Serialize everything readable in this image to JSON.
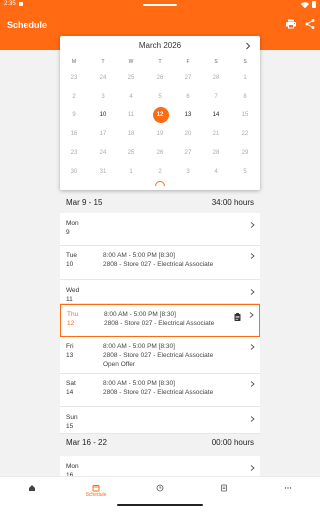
{
  "status_bar": {
    "time": "2:35"
  },
  "app_bar": {
    "title": "Schedule",
    "icons": [
      "print-icon",
      "share-icon"
    ]
  },
  "calendar": {
    "month_title": "March 2026",
    "weekdays": [
      "M",
      "T",
      "W",
      "T",
      "F",
      "S",
      "S"
    ],
    "weeks": [
      [
        {
          "d": "23"
        },
        {
          "d": "24"
        },
        {
          "d": "25"
        },
        {
          "d": "26"
        },
        {
          "d": "27"
        },
        {
          "d": "28"
        },
        {
          "d": "1"
        }
      ],
      [
        {
          "d": "2"
        },
        {
          "d": "3"
        },
        {
          "d": "4"
        },
        {
          "d": "5"
        },
        {
          "d": "6"
        },
        {
          "d": "7"
        },
        {
          "d": "8"
        }
      ],
      [
        {
          "d": "9"
        },
        {
          "d": "10",
          "cur": true
        },
        {
          "d": "11"
        },
        {
          "d": "12",
          "today": true
        },
        {
          "d": "13",
          "cur": true
        },
        {
          "d": "14",
          "cur": true
        },
        {
          "d": "15"
        }
      ],
      [
        {
          "d": "16"
        },
        {
          "d": "17"
        },
        {
          "d": "18"
        },
        {
          "d": "19"
        },
        {
          "d": "20"
        },
        {
          "d": "21"
        },
        {
          "d": "22"
        }
      ],
      [
        {
          "d": "23"
        },
        {
          "d": "24"
        },
        {
          "d": "25"
        },
        {
          "d": "26"
        },
        {
          "d": "27"
        },
        {
          "d": "28"
        },
        {
          "d": "29"
        }
      ],
      [
        {
          "d": "30"
        },
        {
          "d": "31"
        },
        {
          "d": "1"
        },
        {
          "d": "2"
        },
        {
          "d": "3"
        },
        {
          "d": "4"
        },
        {
          "d": "5"
        }
      ]
    ]
  },
  "weeks": [
    {
      "range": "Mar 9 - 15",
      "hours": "34:00 hours",
      "days": [
        {
          "name": "Mon",
          "num": "9",
          "lines": []
        },
        {
          "name": "Tue",
          "num": "10",
          "lines": [
            "8:00 AM - 5:00 PM [8:30]",
            "2808 - Store 027 - Electrical Associate"
          ]
        },
        {
          "name": "Wed",
          "num": "11",
          "lines": []
        },
        {
          "name": "Thu",
          "num": "12",
          "lines": [
            "8:00 AM - 5:00 PM [8:30]",
            "2808 - Store 027 - Electrical Associate"
          ],
          "selected": true,
          "note": true
        },
        {
          "name": "Fri",
          "num": "13",
          "lines": [
            "8:00 AM - 5:00 PM [8:30]",
            "2808 - Store 027 - Electrical Associate",
            "Open Offer"
          ]
        },
        {
          "name": "Sat",
          "num": "14",
          "lines": [
            "8:00 AM - 5:00 PM [8:30]",
            "2808 - Store 027 - Electrical Associate"
          ]
        },
        {
          "name": "Sun",
          "num": "15",
          "lines": []
        }
      ]
    },
    {
      "range": "Mar 16 - 22",
      "hours": "00:00 hours",
      "days": [
        {
          "name": "Mon",
          "num": "16",
          "lines": []
        }
      ]
    }
  ],
  "bottom_nav": {
    "items": [
      {
        "icon": "home-icon",
        "label": ""
      },
      {
        "icon": "calendar-icon",
        "label": "Schedule",
        "active": true
      },
      {
        "icon": "clock-icon",
        "label": ""
      },
      {
        "icon": "timecard-icon",
        "label": ""
      },
      {
        "icon": "more-icon",
        "label": ""
      }
    ]
  },
  "colors": {
    "accent": "#ff6a13",
    "background": "#f2f2f2",
    "surface": "#ffffff"
  }
}
